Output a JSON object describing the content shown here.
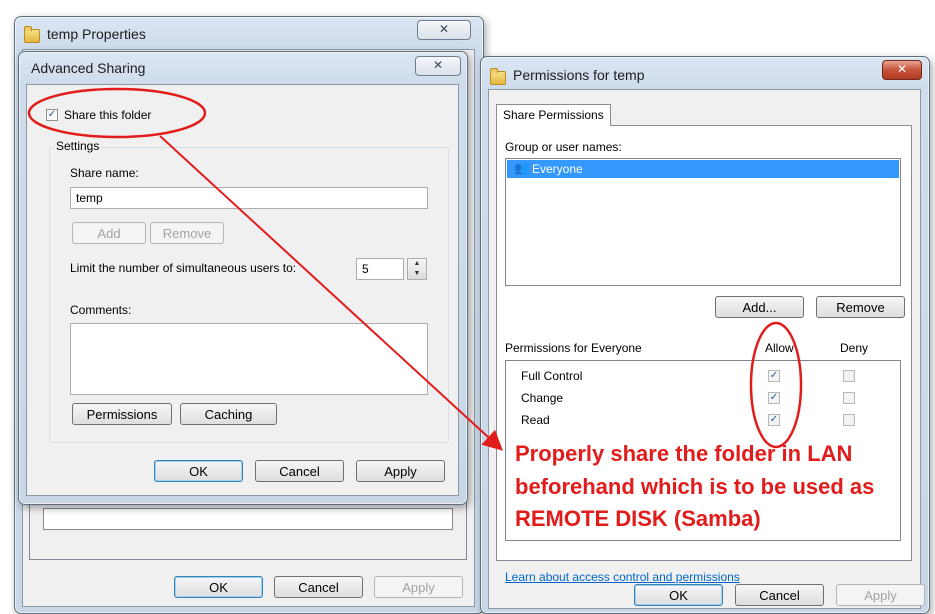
{
  "temp_properties": {
    "title": "temp Properties",
    "close_label": "✕",
    "ok_label": "OK",
    "cancel_label": "Cancel",
    "apply_label": "Apply"
  },
  "advanced_sharing": {
    "title": "Advanced Sharing",
    "close_label": "✕",
    "share_checkbox_label": "Share this folder",
    "share_checked": true,
    "settings_label": "Settings",
    "share_name_label": "Share name:",
    "share_name_value": "temp",
    "add_label": "Add",
    "remove_label": "Remove",
    "limit_label": "Limit the number of simultaneous users to:",
    "limit_value": "5",
    "comments_label": "Comments:",
    "permissions_label": "Permissions",
    "caching_label": "Caching",
    "ok_label": "OK",
    "cancel_label": "Cancel",
    "apply_label": "Apply"
  },
  "permissions_window": {
    "title": "Permissions for temp",
    "close_label": "✕",
    "tab_label": "Share Permissions",
    "group_label": "Group or user names:",
    "users": [
      {
        "name": "Everyone",
        "icon": "users-icon",
        "selected": true
      }
    ],
    "add_label": "Add...",
    "remove_label": "Remove",
    "permissions_header": "Permissions for Everyone",
    "allow_header": "Allow",
    "deny_header": "Deny",
    "permissions": [
      {
        "name": "Full Control",
        "allow": true,
        "deny": false
      },
      {
        "name": "Change",
        "allow": true,
        "deny": false
      },
      {
        "name": "Read",
        "allow": true,
        "deny": false
      }
    ],
    "link_label": "Learn about access control and permissions",
    "ok_label": "OK",
    "cancel_label": "Cancel",
    "apply_label": "Apply"
  },
  "annotation": {
    "lines": [
      "Properly share the folder in LAN",
      "beforehand which is to be used as",
      "REMOTE DISK (Samba)"
    ],
    "color": "#e21b1b"
  }
}
